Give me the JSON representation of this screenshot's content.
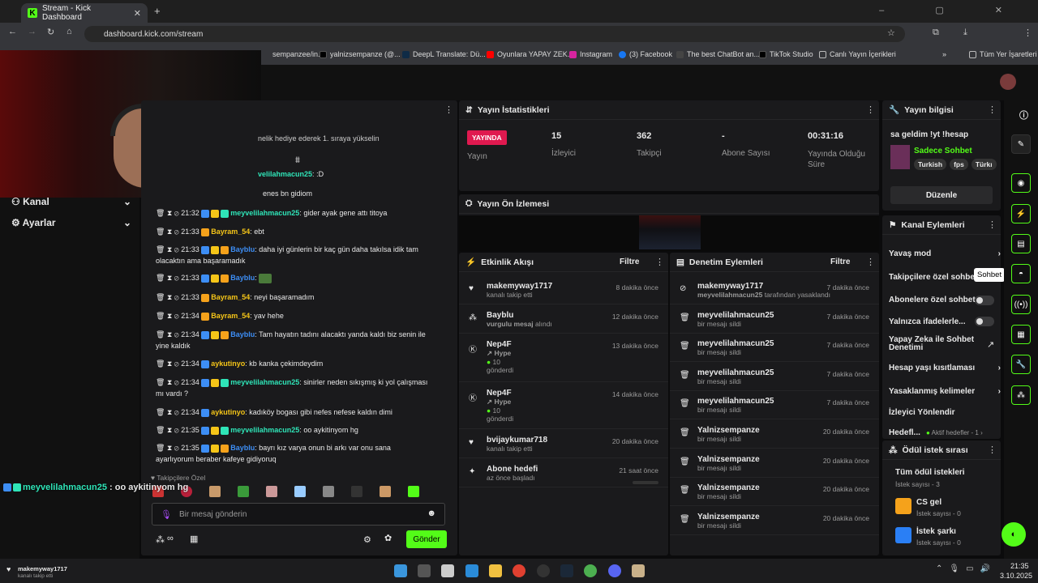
{
  "browser": {
    "tab_title": "Stream - Kick Dashboard",
    "url": "dashboard.kick.com/stream",
    "bookmarks": [
      "sempanzee/in...",
      "yalnizsempanze (@...",
      "DeepL Translate: Dü...",
      "Oyunlara YAPAY ZEK...",
      "Instagram",
      "(3) Facebook",
      "The best ChatBot an...",
      "TikTok Studio",
      "Canlı Yayın İçerikleri",
      "Tüm Yer İşaretleri"
    ]
  },
  "nav": {
    "channel": "Kanal",
    "settings": "Ayarlar"
  },
  "chat": {
    "gift_banner": "nelik hediye ederek 1. sıraya yükselin",
    "top1": ":D",
    "top2": "enes bn gidiom",
    "lines": [
      {
        "t": "21:32",
        "u": "meyvelilahmacun25",
        "m": "gider ayak gene attı titoya",
        "c": "mey"
      },
      {
        "t": "21:33",
        "u": "Bayram_54",
        "m": "ebt",
        "c": "b54"
      },
      {
        "t": "21:33",
        "u": "Bayblu",
        "m": "daha iyi günlerin bir kaç gün daha takılsa idik tam",
        "m2": "olacaktın ama başaramadık",
        "c": "bay"
      },
      {
        "t": "21:33",
        "u": "Bayblu",
        "m": "",
        "c": "bay"
      },
      {
        "t": "21:33",
        "u": "Bayram_54",
        "m": "neyi başaramadım",
        "c": "b54"
      },
      {
        "t": "21:34",
        "u": "Bayram_54",
        "m": "yav hehe",
        "c": "b54"
      },
      {
        "t": "21:34",
        "u": "Bayblu",
        "m": "Tam hayatın tadını alacaktı yanda kaldı biz senin ile",
        "m2": "yine kaldık",
        "c": "bay"
      },
      {
        "t": "21:34",
        "u": "aykutinyo",
        "m": "kb kanka çekimdeydim",
        "c": "ayk"
      },
      {
        "t": "21:34",
        "u": "meyvelilahmacun25",
        "m": "sinirler neden sıkışmış ki yol çalışması",
        "m2": "mı vardı ?",
        "c": "mey"
      },
      {
        "t": "21:34",
        "u": "aykutinyo",
        "m": "kadıköy bogası gibi nefes nefese kaldın dimi",
        "c": "ayk"
      },
      {
        "t": "21:35",
        "u": "meyvelilahmacun25",
        "m": "oo aykitinyom hg",
        "c": "mey"
      },
      {
        "t": "21:35",
        "u": "Bayblu",
        "m": "bayrı kız varya onun bi arkı var onu sana",
        "m2": "ayarlıyorum beraber kafeye gidiyoruq",
        "c": "bay"
      }
    ],
    "overlay_user": "meyvelilahmacun25",
    "overlay_msg": "oo aykitinyom hg",
    "subs_label": "Takipçilere Özel",
    "input_placeholder": "Bir mesaj gönderin",
    "send": "Gönder",
    "inf": "∞"
  },
  "stats": {
    "title": "Yayın İstatistikleri",
    "live": "YAYINDA",
    "live_label": "Yayın",
    "viewers": "15",
    "viewers_label": "İzleyici",
    "followers": "362",
    "followers_label": "Takipçi",
    "subs": "-",
    "subs_label": "Abone Sayısı",
    "duration": "00:31:16",
    "duration_label": "Yayında Olduğu Süre"
  },
  "preview": {
    "title": "Yayın Ön İzlemesi"
  },
  "activity": {
    "title": "Etkinlik Akışı",
    "filter": "Filtre",
    "items": [
      {
        "n": "makemyway1717",
        "s": "kanalı takip etti",
        "t": "8 dakika önce"
      },
      {
        "n": "Bayblu",
        "s1": "vurgulu mesaj",
        "s2": " alındı",
        "t": "12 dakika önce"
      },
      {
        "n": "Nep4F",
        "s1": "Hype",
        "k": "10",
        "s2": "gönderdi",
        "t": "13 dakika önce"
      },
      {
        "n": "Nep4F",
        "s1": "Hype",
        "k": "10",
        "s2": "gönderdi",
        "t": "14 dakika önce"
      },
      {
        "n": "bvijaykumar718",
        "s": "kanalı takip etti",
        "t": "20 dakika önce"
      },
      {
        "n": "Abone hedefi",
        "s": "az önce başladı",
        "t": "21 saat önce"
      }
    ]
  },
  "moderation": {
    "title": "Denetim Eylemleri",
    "filter": "Filtre",
    "items": [
      {
        "n": "makemyway1717",
        "s1": "meyvelilahmacun25",
        "s2": " tarafından yasaklandı",
        "t": "7 dakika önce"
      },
      {
        "n": "meyvelilahmacun25",
        "s": "bir mesajı sildi",
        "t": "7 dakika önce"
      },
      {
        "n": "meyvelilahmacun25",
        "s": "bir mesajı sildi",
        "t": "7 dakika önce"
      },
      {
        "n": "meyvelilahmacun25",
        "s": "bir mesajı sildi",
        "t": "7 dakika önce"
      },
      {
        "n": "meyvelilahmacun25",
        "s": "bir mesajı sildi",
        "t": "7 dakika önce"
      },
      {
        "n": "Yalnizsempanze",
        "s": "bir mesajı sildi",
        "t": "20 dakika önce"
      },
      {
        "n": "Yalnizsempanze",
        "s": "bir mesajı sildi",
        "t": "20 dakika önce"
      },
      {
        "n": "Yalnizsempanze",
        "s": "bir mesajı sildi",
        "t": "20 dakika önce"
      },
      {
        "n": "Yalnizsempanze",
        "s": "bir mesajı sildi",
        "t": "20 dakika önce"
      }
    ]
  },
  "info": {
    "title": "Yayın bilgisi",
    "stream_title": "sa geldim !yt !hesap",
    "category": "Sadece Sohbet",
    "tags": [
      "Turkish",
      "fps",
      "Türkı"
    ],
    "edit": "Düzenle"
  },
  "actions": {
    "title": "Kanal Eylemleri",
    "items": [
      "Yavaş mod",
      "Takipçilere özel sohbet",
      "Abonelere özel sohbet",
      "Yalnızca ifadelerle...",
      "Yapay Zeka ile Sohbet Denetimi",
      "Hesap yaşı kısıtlaması",
      "Yasaklanmış kelimeler",
      "İzleyici Yönlendir",
      "Hedefl..."
    ],
    "goals_badge": "Aktif hedefler - 1",
    "tooltip": "Sohbet"
  },
  "rewards": {
    "title": "Ödül istek sırası",
    "all": "Tüm ödül istekleri",
    "all_count": "İstek sayısı - 3",
    "items": [
      {
        "n": "CS gel",
        "c": "İstek sayısı - 0"
      },
      {
        "n": "İstek şarkı",
        "c": "İstek sayısı - 0"
      }
    ]
  },
  "notification": {
    "user": "makemyway1717",
    "text": "kanalı takip etti"
  },
  "taskbar": {
    "time": "21:35",
    "date": "3.10.2025"
  }
}
